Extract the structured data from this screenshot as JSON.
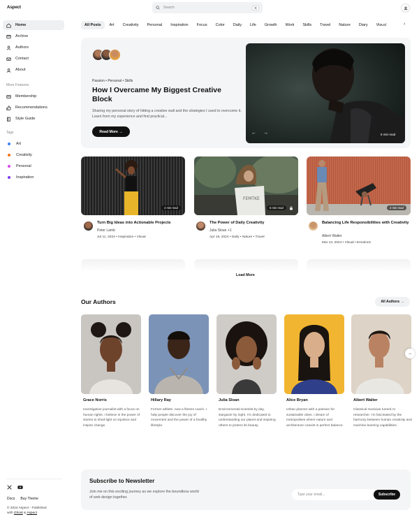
{
  "brand": "Aspect",
  "sidebar": {
    "nav": [
      {
        "label": "Home",
        "icon": "home-icon"
      },
      {
        "label": "Archive",
        "icon": "archive-icon"
      },
      {
        "label": "Authors",
        "icon": "user-icon"
      },
      {
        "label": "Contact",
        "icon": "mail-icon"
      },
      {
        "label": "About",
        "icon": "user-circle-icon"
      }
    ],
    "more_title": "More Features",
    "more": [
      {
        "label": "Membership",
        "icon": "membership-icon"
      },
      {
        "label": "Recommendations",
        "icon": "thumbs-up-icon"
      },
      {
        "label": "Style Guide",
        "icon": "book-icon"
      }
    ],
    "tags_title": "Tags",
    "tags": [
      {
        "label": "Art",
        "color": "#3b82f6"
      },
      {
        "label": "Creativity",
        "color": "#f97316"
      },
      {
        "label": "Personal",
        "color": "#d946ef"
      },
      {
        "label": "Inspiration",
        "color": "#7c3aed"
      }
    ],
    "footer_links": [
      "Docs",
      "Buy Theme"
    ],
    "copyright_line1": "© 2024 Aspect - Published",
    "copyright_with": "with",
    "copyright_ghost": "Ghost",
    "copyright_amp": "&",
    "copyright_aspect": "Aspect"
  },
  "search": {
    "placeholder": "Search",
    "shortcut": "⌘"
  },
  "tabs": [
    "All Posts",
    "Art",
    "Creativity",
    "Personal",
    "Inspiration",
    "Focus",
    "Color",
    "Daily",
    "Life",
    "Growth",
    "Work",
    "Skills",
    "Travel",
    "Nature",
    "Diary",
    "Visual"
  ],
  "hero": {
    "categories": "Passion • Personal • Skills",
    "title": "How I Overcame My Biggest Creative Block",
    "excerpt": "Sharing my personal story of hitting a creative wall and the strategies I used to overcome it. Learn from my experience and find practical...",
    "button": "Read More →",
    "prev": "←",
    "next": "→",
    "read_time": "5 min read"
  },
  "posts": [
    {
      "title": "Turn Big Ideas into Actionable Projects",
      "author": "Peter Lamb",
      "meta": "Jul 11, 2024 • Inspiration • Visual",
      "read_time": "2 min read"
    },
    {
      "title": "The Power of Daily Creativity",
      "author": "Julia Sloan +1",
      "meta": "Apr 19, 2024 • Daily • Nature • Travel",
      "read_time": "5 min read"
    },
    {
      "title": "Balancing Life Responsibilities with Creativity",
      "author": "Albert Walter",
      "meta": "Mar 13, 2024 • Visual • Emotions",
      "read_time": "2 min read"
    }
  ],
  "load_more": "Load More",
  "authors_section": {
    "title": "Our Authors",
    "all_button": "All Authors →",
    "next": "→",
    "authors": [
      {
        "name": "Grace Norris",
        "bio": "Investigative journalist with a focus on human rights. I believe in the power of stories to shed light on injustice and inspire change."
      },
      {
        "name": "Hillary Ray",
        "bio": "Former athlete, now a fitness coach. I help people discover the joy of movement and the power of a healthy lifestyle."
      },
      {
        "name": "Julia Sloan",
        "bio": "Environmental scientist by day, stargazer by night. I'm dedicated to understanding our planet and inspiring others to protect its beauty."
      },
      {
        "name": "Alice Bryan",
        "bio": "Urban planner with a passion for sustainable cities. I dream of metropolises where nature and architecture coexist in perfect balance."
      },
      {
        "name": "Albert Walter",
        "bio": "Classical musician turned AI researcher. I'm fascinated by the harmony between human creativity and machine learning capabilities."
      }
    ]
  },
  "newsletter": {
    "title": "Subscribe to Newsletter",
    "text": "Join me on this exciting journey as we explore the boundless world of web design together.",
    "placeholder": "Type your email...",
    "button": "Subscribe"
  }
}
